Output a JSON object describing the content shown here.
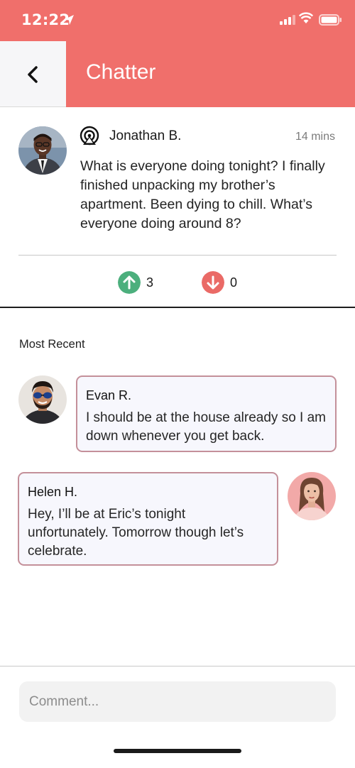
{
  "status_bar": {
    "time": "12:22"
  },
  "header": {
    "title": "Chatter",
    "back_icon": "chevron-left-icon"
  },
  "post": {
    "author": "Jonathan B.",
    "time": "14 mins",
    "text": "What is everyone doing tonight? I finally finished unpacking my brother’s apartment. Been dying to chill. What’s everyone doing around 8?",
    "upvotes": "3",
    "downvotes": "0"
  },
  "section_label": "Most Recent",
  "comments": [
    {
      "name": "Evan R.",
      "text": "I should be at the house already so I am down whenever you get back."
    },
    {
      "name": "Helen H.",
      "text": "Hey, I’ll be at Eric’s tonight unfortunately. Tomorrow though let’s celebrate."
    }
  ],
  "comment_input": {
    "placeholder": "Comment..."
  },
  "colors": {
    "brand": "#f06f6b",
    "upvote": "#4caf7d",
    "downvote": "#ea6a66",
    "bubble_border": "#c4909a"
  }
}
